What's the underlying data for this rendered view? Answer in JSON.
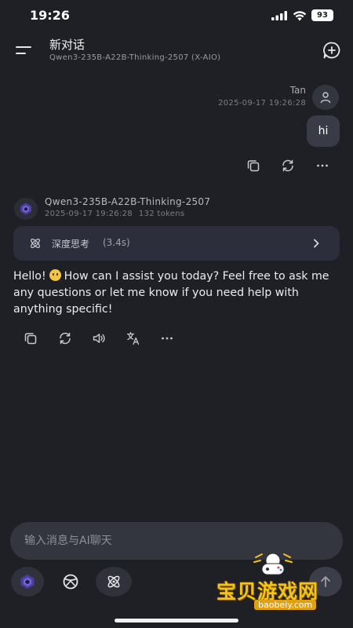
{
  "status_bar": {
    "time": "19:26",
    "battery": "93"
  },
  "header": {
    "title": "新对话",
    "subtitle": "Qwen3-235B-A22B-Thinking-2507 (X-AIO)"
  },
  "user_message": {
    "name": "Tan",
    "timestamp": "2025-09-17 19:26:28",
    "text": "hi",
    "actions": [
      "copy-icon",
      "regenerate-icon",
      "more-icon"
    ]
  },
  "ai_message": {
    "model": "Qwen3-235B-A22B-Thinking-2507",
    "timestamp": "2025-09-17 19:26:28",
    "tokens": "132 tokens",
    "thinking": {
      "label": "深度思考",
      "duration": "(3.4s)"
    },
    "text_before_emoji": "Hello!",
    "text_after_emoji": "How can I assist you today? Feel free to ask me any questions or let me know if you need help with anything specific!",
    "actions": [
      "copy-icon",
      "regenerate-icon",
      "speaker-icon",
      "translate-icon",
      "more-icon"
    ]
  },
  "input": {
    "placeholder": "输入消息与AI聊天"
  },
  "watermark": {
    "text": "宝贝游戏网",
    "url": "baobeiy.com"
  },
  "colors": {
    "background": "#1f2026",
    "bubble": "#393b46",
    "accent": "#f4c21d"
  }
}
